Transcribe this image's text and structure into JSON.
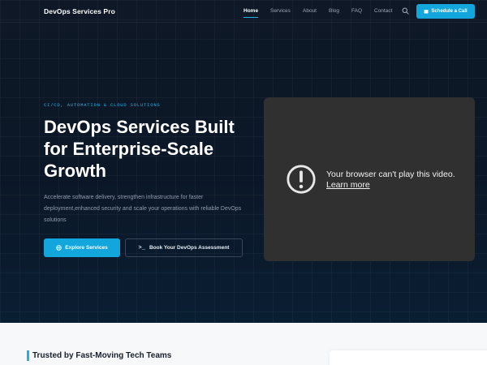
{
  "nav": {
    "brand": "DevOps Services Pro",
    "links": [
      {
        "label": "Home",
        "active": true
      },
      {
        "label": "Services",
        "active": false
      },
      {
        "label": "About",
        "active": false
      },
      {
        "label": "Blog",
        "active": false
      },
      {
        "label": "FAQ",
        "active": false
      },
      {
        "label": "Contact",
        "active": false
      }
    ],
    "search_icon": "search-icon",
    "cta_label": "Schedule a Call",
    "cta_icon": "calendar-icon"
  },
  "hero": {
    "kicker": "CI/CD, AUTOMATION & CLOUD SOLUTIONS",
    "headline": "DevOps Services Built for Enterprise-Scale Growth",
    "description": "Accelerate software delivery, strengthen infrastructure for faster deployment,enhanced security and scale your operations with reliable DevOps solutions",
    "primary_button": {
      "label": "Explore Services",
      "icon": "globe-icon"
    },
    "secondary_button": {
      "label": "Book Your DevOps Assessment",
      "icon": ">_"
    }
  },
  "video": {
    "message": "Your browser can't play this video.",
    "link_label": "Learn more",
    "icon": "alert-circle-icon"
  },
  "trusted": {
    "title": "Trusted by Fast-Moving Tech Teams"
  },
  "colors": {
    "accent": "#12a6dc",
    "background": "#0b1524",
    "video_bg": "#303030"
  }
}
